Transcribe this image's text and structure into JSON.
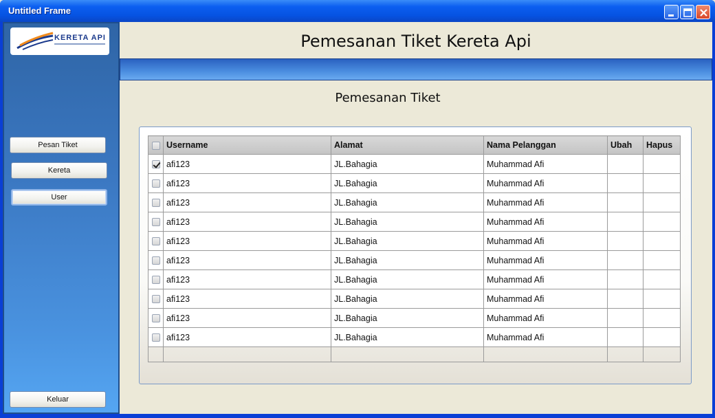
{
  "window": {
    "title": "Untitled Frame"
  },
  "logo": {
    "text": "KERETA API"
  },
  "sidebar": {
    "buttons": [
      {
        "label": "Pesan Tiket"
      },
      {
        "label": "Kereta"
      },
      {
        "label": "User"
      }
    ],
    "exit_label": "Keluar"
  },
  "header": {
    "title": "Pemesanan Tiket Kereta Api"
  },
  "section": {
    "title": "Pemesanan Tiket"
  },
  "table": {
    "columns": [
      "Username",
      "Alamat",
      "Nama Pelanggan",
      "Ubah",
      "Hapus"
    ],
    "rows": [
      {
        "checked": true,
        "username": "afi123",
        "alamat": "JL.Bahagia",
        "nama": "Muhammad Afi"
      },
      {
        "checked": false,
        "username": "afi123",
        "alamat": "JL.Bahagia",
        "nama": "Muhammad Afi"
      },
      {
        "checked": false,
        "username": "afi123",
        "alamat": "JL.Bahagia",
        "nama": "Muhammad Afi"
      },
      {
        "checked": false,
        "username": "afi123",
        "alamat": "JL.Bahagia",
        "nama": "Muhammad Afi"
      },
      {
        "checked": false,
        "username": "afi123",
        "alamat": "JL.Bahagia",
        "nama": "Muhammad Afi"
      },
      {
        "checked": false,
        "username": "afi123",
        "alamat": "JL.Bahagia",
        "nama": "Muhammad Afi"
      },
      {
        "checked": false,
        "username": "afi123",
        "alamat": "JL.Bahagia",
        "nama": "Muhammad Afi"
      },
      {
        "checked": false,
        "username": "afi123",
        "alamat": "JL.Bahagia",
        "nama": "Muhammad Afi"
      },
      {
        "checked": false,
        "username": "afi123",
        "alamat": "JL.Bahagia",
        "nama": "Muhammad Afi"
      },
      {
        "checked": false,
        "username": "afi123",
        "alamat": "JL.Bahagia",
        "nama": "Muhammad Afi"
      }
    ]
  },
  "colors": {
    "titlebar": "#0653e2",
    "sidebar": "#3b78c2",
    "band": "#4b8ee0",
    "background": "#ece9d8"
  }
}
